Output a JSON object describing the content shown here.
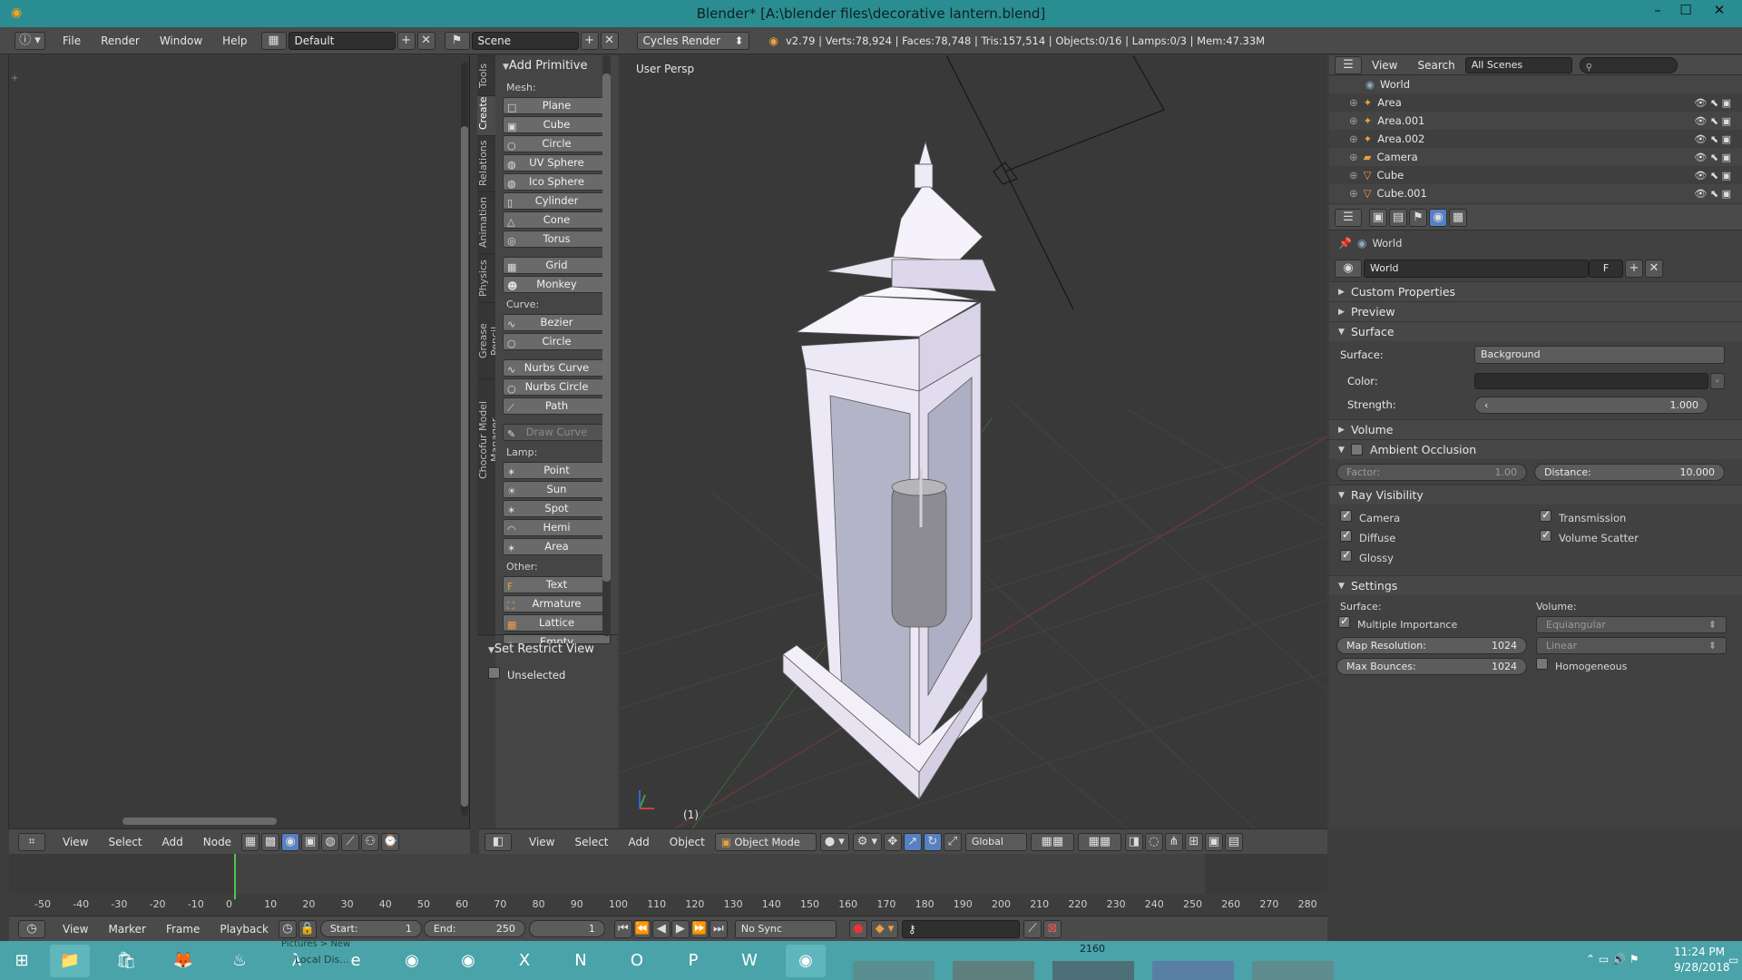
{
  "window": {
    "title": "Blender* [A:\\blender files\\decorative lantern.blend]",
    "min": "–",
    "max": "☐",
    "close": "✕"
  },
  "info": {
    "menus": [
      "File",
      "Render",
      "Window",
      "Help"
    ],
    "layout": "Default",
    "scene": "Scene",
    "engine": "Cycles Render",
    "stats": "v2.79 | Verts:78,924 | Faces:78,748 | Tris:157,514 | Objects:0/16 | Lamps:0/3 | Mem:47.33M"
  },
  "tabs": [
    "Tools",
    "Create",
    "Relations",
    "Animation",
    "Physics",
    "Grease Pencil",
    "Chocofur Model Manager"
  ],
  "toolshelf": {
    "panel_title": "Add Primitive",
    "mesh_label": "Mesh:",
    "mesh": [
      "Plane",
      "Cube",
      "Circle",
      "UV Sphere",
      "Ico Sphere",
      "Cylinder",
      "Cone",
      "Torus"
    ],
    "mesh2": [
      "Grid",
      "Monkey"
    ],
    "curve_label": "Curve:",
    "curve": [
      "Bezier",
      "Circle"
    ],
    "curve2": [
      "Nurbs Curve",
      "Nurbs Circle",
      "Path"
    ],
    "draw_curve": "Draw Curve",
    "lamp_label": "Lamp:",
    "lamp": [
      "Point",
      "Sun",
      "Spot",
      "Hemi",
      "Area"
    ],
    "other_label": "Other:",
    "other": [
      "Text",
      "Armature",
      "Lattice",
      "Empty"
    ],
    "restrict_title": "Set Restrict View",
    "unselected": "Unselected"
  },
  "viewport": {
    "label": "User Persp",
    "frame": "(1)"
  },
  "outliner": {
    "menus": [
      "View",
      "Search"
    ],
    "filter": "All Scenes",
    "items": [
      "World",
      "Area",
      "Area.001",
      "Area.002",
      "Camera",
      "Cube",
      "Cube.001"
    ]
  },
  "props": {
    "breadcrumb": "World",
    "world_name": "World",
    "fake": "F",
    "sections": {
      "custom": "Custom Properties",
      "preview": "Preview",
      "surface": "Surface",
      "volume": "Volume",
      "ao": "Ambient Occlusion",
      "ray": "Ray Visibility",
      "settings": "Settings"
    },
    "surface_label": "Surface:",
    "surface_value": "Background",
    "color_label": "Color:",
    "strength_label": "Strength:",
    "strength_value": "1.000",
    "factor_label": "Factor:",
    "factor_value": "1.00",
    "distance_label": "Distance:",
    "distance_value": "10.000",
    "ray": [
      "Camera",
      "Transmission",
      "Diffuse",
      "Volume Scatter",
      "Glossy"
    ],
    "settings_surface": "Surface:",
    "settings_volume": "Volume:",
    "multiple_importance": "Multiple Importance",
    "equiangular": "Equiangular",
    "map_res_label": "Map Resolution:",
    "map_res_value": "1024",
    "linear": "Linear",
    "max_bounces_label": "Max Bounces:",
    "max_bounces_value": "1024",
    "homogeneous": "Homogeneous"
  },
  "node_header": {
    "menus": [
      "View",
      "Select",
      "Add",
      "Node"
    ]
  },
  "view3d_header": {
    "menus": [
      "View",
      "Select",
      "Add",
      "Object"
    ],
    "mode": "Object Mode",
    "orientation": "Global"
  },
  "timeline": {
    "ticks": [
      "-50",
      "-40",
      "-30",
      "-20",
      "-10",
      "0",
      "10",
      "20",
      "30",
      "40",
      "50",
      "60",
      "70",
      "80",
      "90",
      "100",
      "110",
      "120",
      "130",
      "140",
      "150",
      "160",
      "170",
      "180",
      "190",
      "200",
      "210",
      "220",
      "230",
      "240",
      "250",
      "260",
      "270",
      "280"
    ],
    "menus": [
      "View",
      "Marker",
      "Frame",
      "Playback"
    ],
    "start_label": "Start:",
    "start": "1",
    "end_label": "End:",
    "end": "250",
    "current": "1",
    "sync": "No Sync"
  },
  "taskbar": {
    "time": "11:24 PM",
    "date": "9/28/2018",
    "res": "2160",
    "ghost1": "Pictures > New",
    "ghost2": "Local Dis..."
  }
}
